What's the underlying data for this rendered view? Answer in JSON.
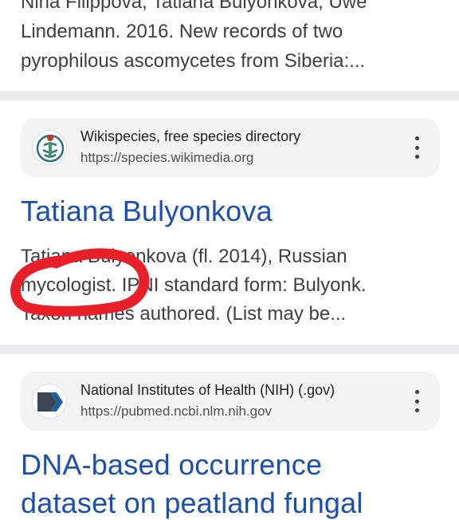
{
  "previous_result": {
    "snippet_lines": [
      "Nina Filippova, Tatiana Bulyonkova, Uwe",
      "Lindemann. 2016. New records of two",
      "pyrophilous ascomycetes from Siberia:..."
    ]
  },
  "results": [
    {
      "source_name": "Wikispecies, free species directory",
      "source_url": "https://species.wikimedia.org",
      "favicon": "wikispecies-logo-icon",
      "title": "Tatiana Bulyonkova",
      "snippet_lines": [
        "Tatiana Bulyonkova (fl. 2014), Russian",
        "mycologist. IPNI standard form: Bulyonk.",
        "Taxon names authored. (List may be..."
      ],
      "annotation": "red-freehand-circle"
    },
    {
      "source_name": "National Institutes of Health (NIH) (.gov)",
      "source_url": "https://pubmed.ncbi.nlm.nih.gov",
      "favicon": "nih-logo-icon",
      "title_lines": [
        "DNA-based occurrence",
        "dataset on peatland fungal"
      ]
    }
  ],
  "colors": {
    "title_link": "#1a4fb0",
    "annotation": "#e8202a",
    "card_bg": "#f1f3f4",
    "divider": "#e8eaed"
  }
}
